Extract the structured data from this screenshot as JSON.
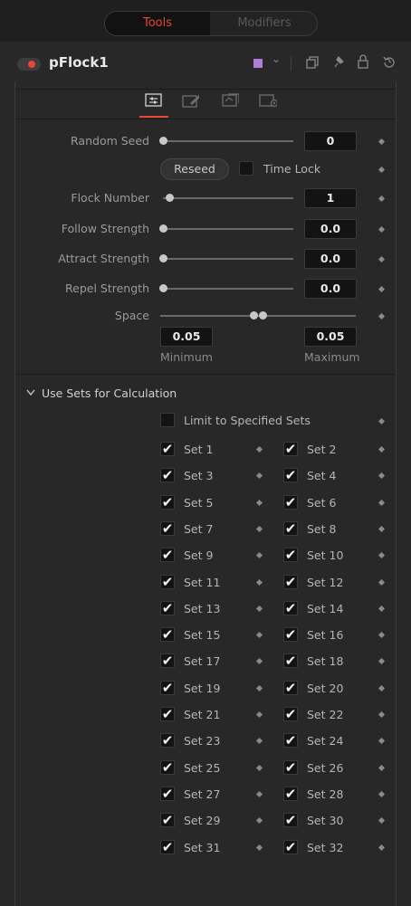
{
  "tabs": {
    "tools": "Tools",
    "modifiers": "Modifiers"
  },
  "header": {
    "tool_name": "pFlock1",
    "color_swatch": "#b07cd8"
  },
  "controls": {
    "random_seed": {
      "label": "Random Seed",
      "value": "0"
    },
    "reseed_label": "Reseed",
    "time_lock_label": "Time Lock",
    "flock_number": {
      "label": "Flock Number",
      "value": "1"
    },
    "follow_strength": {
      "label": "Follow Strength",
      "value": "0.0"
    },
    "attract_strength": {
      "label": "Attract Strength",
      "value": "0.0"
    },
    "repel_strength": {
      "label": "Repel Strength",
      "value": "0.0"
    },
    "space": {
      "label": "Space",
      "min_value": "0.05",
      "max_value": "0.05",
      "min_label": "Minimum",
      "max_label": "Maximum"
    }
  },
  "sets_section": {
    "title": "Use Sets for Calculation",
    "limit_label": "Limit to Specified Sets",
    "sets": [
      "Set 1",
      "Set 2",
      "Set 3",
      "Set 4",
      "Set 5",
      "Set 6",
      "Set 7",
      "Set 8",
      "Set 9",
      "Set 10",
      "Set 11",
      "Set 12",
      "Set 13",
      "Set 14",
      "Set 15",
      "Set 16",
      "Set 17",
      "Set 18",
      "Set 19",
      "Set 20",
      "Set 21",
      "Set 22",
      "Set 23",
      "Set 24",
      "Set 25",
      "Set 26",
      "Set 27",
      "Set 28",
      "Set 29",
      "Set 30",
      "Set 31",
      "Set 32"
    ]
  },
  "icons": {
    "check": "✔",
    "chevron": "⌄",
    "collapse": "⌄"
  }
}
